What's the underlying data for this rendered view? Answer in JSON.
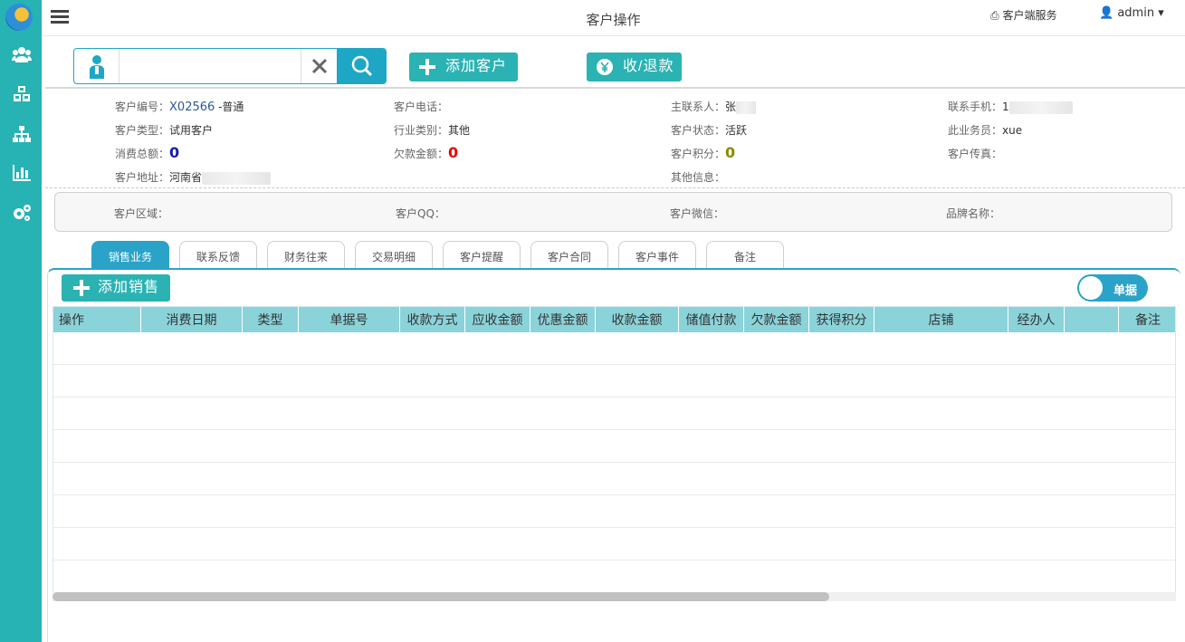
{
  "topbar": {
    "title": "客户操作",
    "client_service": "客户端服务",
    "user": "admin"
  },
  "sidebar": {
    "items": [
      {
        "icon": "users-icon"
      },
      {
        "icon": "cubes-icon"
      },
      {
        "icon": "sitemap-icon"
      },
      {
        "icon": "bar-chart-icon"
      },
      {
        "icon": "gears-icon"
      }
    ]
  },
  "toolbar": {
    "search_value": "",
    "add_customer_label": "添加客户",
    "payment_label": "收/退款"
  },
  "customer": {
    "id_label": "客户编号：",
    "id_value": "X02566",
    "id_grade": " -普通",
    "phone_label": "客户电话：",
    "contact_label": "主联系人：",
    "contact_value": "张",
    "mobile_label": "联系手机：",
    "mobile_value": "1",
    "type_label": "客户类型：",
    "type_value": "试用客户",
    "industry_label": "行业类别：",
    "industry_value": "其他",
    "status_label": "客户状态：",
    "status_value": "活跃",
    "salesman_label": "此业务员：",
    "salesman_value": "xue",
    "total_label": "消费总额：",
    "total_value": "0",
    "debt_label": "欠款金额：",
    "debt_value": "0",
    "points_label": "客户积分：",
    "points_value": "0",
    "fax_label": "客户传真：",
    "address_label": "客户地址：",
    "address_value": "河南省",
    "other_label": "其他信息："
  },
  "extra": {
    "region_label": "客户区域：",
    "qq_label": "客户QQ：",
    "wechat_label": "客户微信：",
    "brand_label": "品牌名称："
  },
  "tabs": [
    "销售业务",
    "联系反馈",
    "财务往来",
    "交易明细",
    "客户提醒",
    "客户合同",
    "客户事件",
    "备注"
  ],
  "sales": {
    "add_label": "添加销售",
    "toggle_label": "单据",
    "columns": [
      "操作",
      "消费日期",
      "类型",
      "单据号",
      "收款方式",
      "应收金额",
      "优惠金额",
      "收款金额",
      "储值付款",
      "欠款金额",
      "获得积分",
      "店铺",
      "经办人",
      "",
      "备注"
    ],
    "rows": []
  },
  "colors": {
    "sidebar": "#27b2b3",
    "accent": "#1ea7c5",
    "header": "#8ad3d9"
  }
}
